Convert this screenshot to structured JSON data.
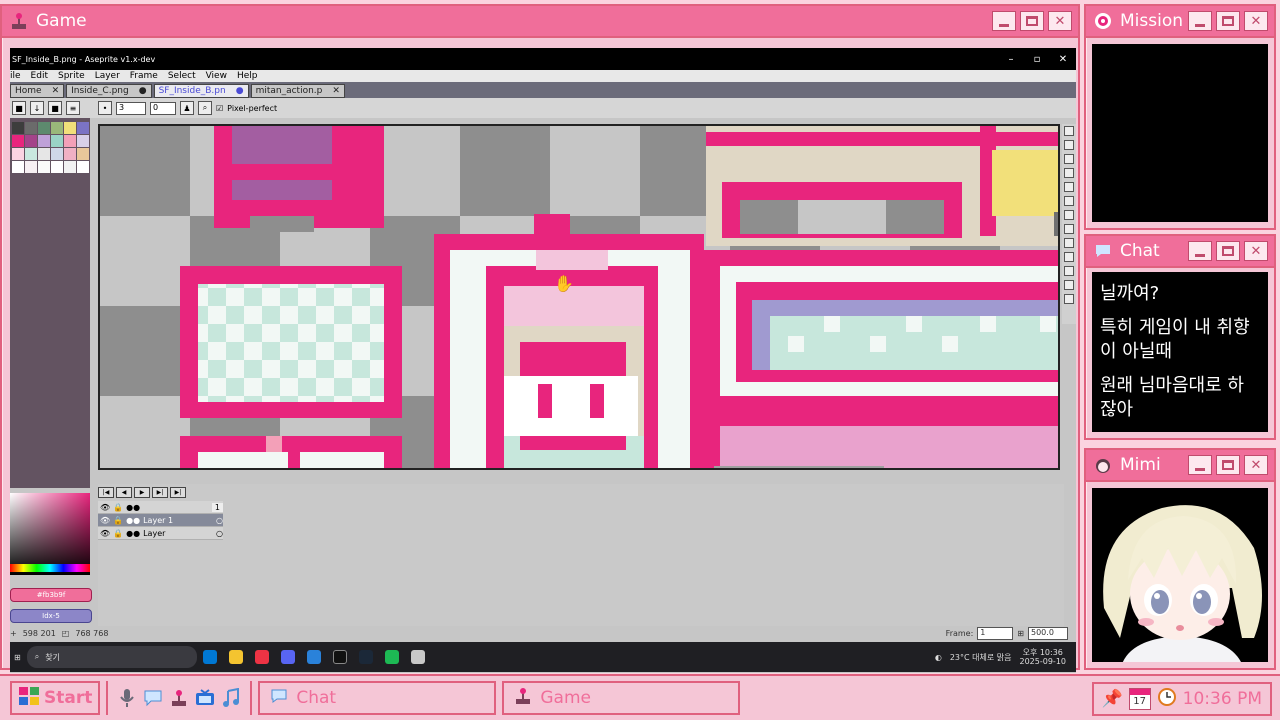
{
  "game_window": {
    "title": "Game",
    "icon": "joystick-icon"
  },
  "aseprite": {
    "title": "SF_Inside_B.png - Aseprite v1.x-dev",
    "menu": [
      "ile",
      "Edit",
      "Sprite",
      "Layer",
      "Frame",
      "Select",
      "View",
      "Help"
    ],
    "tabs": [
      {
        "label": "Home",
        "active": false
      },
      {
        "label": "Inside_C.png",
        "active": false
      },
      {
        "label": "SF_Inside_B.pn",
        "active": true
      },
      {
        "label": "mitan_action.p",
        "active": false
      }
    ],
    "toolbar": {
      "brush_size": "3",
      "angle": "0",
      "pixel_perfect": "Pixel-perfect"
    },
    "fg_color_label": "#fb3b9f",
    "index_label": "Idx-5",
    "timeline": {
      "frame_number": "1",
      "layers": [
        "Layer 1",
        "Layer"
      ]
    },
    "status": {
      "pos": "598 201",
      "size": "768 768",
      "frame_label": "Frame:",
      "frame_value": "1",
      "zoom": "500.0"
    },
    "windows_taskbar": {
      "search": "찾기",
      "weather": "23°C 대체로 맑음",
      "time": "오후 10:36",
      "date": "2025-09-10"
    }
  },
  "mission_window": {
    "title": "Mission",
    "icon": "target-icon"
  },
  "chat_window": {
    "title": "Chat",
    "icon": "speech-bubble-icon",
    "messages": [
      "닐까여?",
      "특히 게임이 내 취향이 아닐때",
      "원래 님마음대로 하잖아"
    ]
  },
  "mimi_window": {
    "title": "Mimi",
    "icon": "girl-face-icon"
  },
  "taskbar": {
    "start_label": "Start",
    "chat_label": "Chat",
    "game_label": "Game",
    "calendar_day": "17",
    "clock": "10:36 PM"
  },
  "colors": {
    "accent": "#f06e9a",
    "border": "#e0607e",
    "panel": "#f5c6d6",
    "pixel_pink": "#e8257d"
  }
}
